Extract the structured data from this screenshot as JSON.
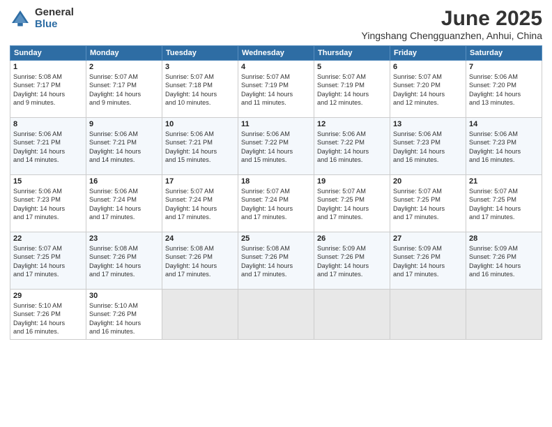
{
  "logo": {
    "general": "General",
    "blue": "Blue"
  },
  "title": "June 2025",
  "subtitle": "Yingshang Chengguanzhen, Anhui, China",
  "days_header": [
    "Sunday",
    "Monday",
    "Tuesday",
    "Wednesday",
    "Thursday",
    "Friday",
    "Saturday"
  ],
  "weeks": [
    [
      {
        "day": "1",
        "info": "Sunrise: 5:08 AM\nSunset: 7:17 PM\nDaylight: 14 hours\nand 9 minutes."
      },
      {
        "day": "2",
        "info": "Sunrise: 5:07 AM\nSunset: 7:17 PM\nDaylight: 14 hours\nand 9 minutes."
      },
      {
        "day": "3",
        "info": "Sunrise: 5:07 AM\nSunset: 7:18 PM\nDaylight: 14 hours\nand 10 minutes."
      },
      {
        "day": "4",
        "info": "Sunrise: 5:07 AM\nSunset: 7:19 PM\nDaylight: 14 hours\nand 11 minutes."
      },
      {
        "day": "5",
        "info": "Sunrise: 5:07 AM\nSunset: 7:19 PM\nDaylight: 14 hours\nand 12 minutes."
      },
      {
        "day": "6",
        "info": "Sunrise: 5:07 AM\nSunset: 7:20 PM\nDaylight: 14 hours\nand 12 minutes."
      },
      {
        "day": "7",
        "info": "Sunrise: 5:06 AM\nSunset: 7:20 PM\nDaylight: 14 hours\nand 13 minutes."
      }
    ],
    [
      {
        "day": "8",
        "info": "Sunrise: 5:06 AM\nSunset: 7:21 PM\nDaylight: 14 hours\nand 14 minutes."
      },
      {
        "day": "9",
        "info": "Sunrise: 5:06 AM\nSunset: 7:21 PM\nDaylight: 14 hours\nand 14 minutes."
      },
      {
        "day": "10",
        "info": "Sunrise: 5:06 AM\nSunset: 7:21 PM\nDaylight: 14 hours\nand 15 minutes."
      },
      {
        "day": "11",
        "info": "Sunrise: 5:06 AM\nSunset: 7:22 PM\nDaylight: 14 hours\nand 15 minutes."
      },
      {
        "day": "12",
        "info": "Sunrise: 5:06 AM\nSunset: 7:22 PM\nDaylight: 14 hours\nand 16 minutes."
      },
      {
        "day": "13",
        "info": "Sunrise: 5:06 AM\nSunset: 7:23 PM\nDaylight: 14 hours\nand 16 minutes."
      },
      {
        "day": "14",
        "info": "Sunrise: 5:06 AM\nSunset: 7:23 PM\nDaylight: 14 hours\nand 16 minutes."
      }
    ],
    [
      {
        "day": "15",
        "info": "Sunrise: 5:06 AM\nSunset: 7:23 PM\nDaylight: 14 hours\nand 17 minutes."
      },
      {
        "day": "16",
        "info": "Sunrise: 5:06 AM\nSunset: 7:24 PM\nDaylight: 14 hours\nand 17 minutes."
      },
      {
        "day": "17",
        "info": "Sunrise: 5:07 AM\nSunset: 7:24 PM\nDaylight: 14 hours\nand 17 minutes."
      },
      {
        "day": "18",
        "info": "Sunrise: 5:07 AM\nSunset: 7:24 PM\nDaylight: 14 hours\nand 17 minutes."
      },
      {
        "day": "19",
        "info": "Sunrise: 5:07 AM\nSunset: 7:25 PM\nDaylight: 14 hours\nand 17 minutes."
      },
      {
        "day": "20",
        "info": "Sunrise: 5:07 AM\nSunset: 7:25 PM\nDaylight: 14 hours\nand 17 minutes."
      },
      {
        "day": "21",
        "info": "Sunrise: 5:07 AM\nSunset: 7:25 PM\nDaylight: 14 hours\nand 17 minutes."
      }
    ],
    [
      {
        "day": "22",
        "info": "Sunrise: 5:07 AM\nSunset: 7:25 PM\nDaylight: 14 hours\nand 17 minutes."
      },
      {
        "day": "23",
        "info": "Sunrise: 5:08 AM\nSunset: 7:26 PM\nDaylight: 14 hours\nand 17 minutes."
      },
      {
        "day": "24",
        "info": "Sunrise: 5:08 AM\nSunset: 7:26 PM\nDaylight: 14 hours\nand 17 minutes."
      },
      {
        "day": "25",
        "info": "Sunrise: 5:08 AM\nSunset: 7:26 PM\nDaylight: 14 hours\nand 17 minutes."
      },
      {
        "day": "26",
        "info": "Sunrise: 5:09 AM\nSunset: 7:26 PM\nDaylight: 14 hours\nand 17 minutes."
      },
      {
        "day": "27",
        "info": "Sunrise: 5:09 AM\nSunset: 7:26 PM\nDaylight: 14 hours\nand 17 minutes."
      },
      {
        "day": "28",
        "info": "Sunrise: 5:09 AM\nSunset: 7:26 PM\nDaylight: 14 hours\nand 16 minutes."
      }
    ],
    [
      {
        "day": "29",
        "info": "Sunrise: 5:10 AM\nSunset: 7:26 PM\nDaylight: 14 hours\nand 16 minutes."
      },
      {
        "day": "30",
        "info": "Sunrise: 5:10 AM\nSunset: 7:26 PM\nDaylight: 14 hours\nand 16 minutes."
      },
      {
        "day": "",
        "info": ""
      },
      {
        "day": "",
        "info": ""
      },
      {
        "day": "",
        "info": ""
      },
      {
        "day": "",
        "info": ""
      },
      {
        "day": "",
        "info": ""
      }
    ]
  ]
}
